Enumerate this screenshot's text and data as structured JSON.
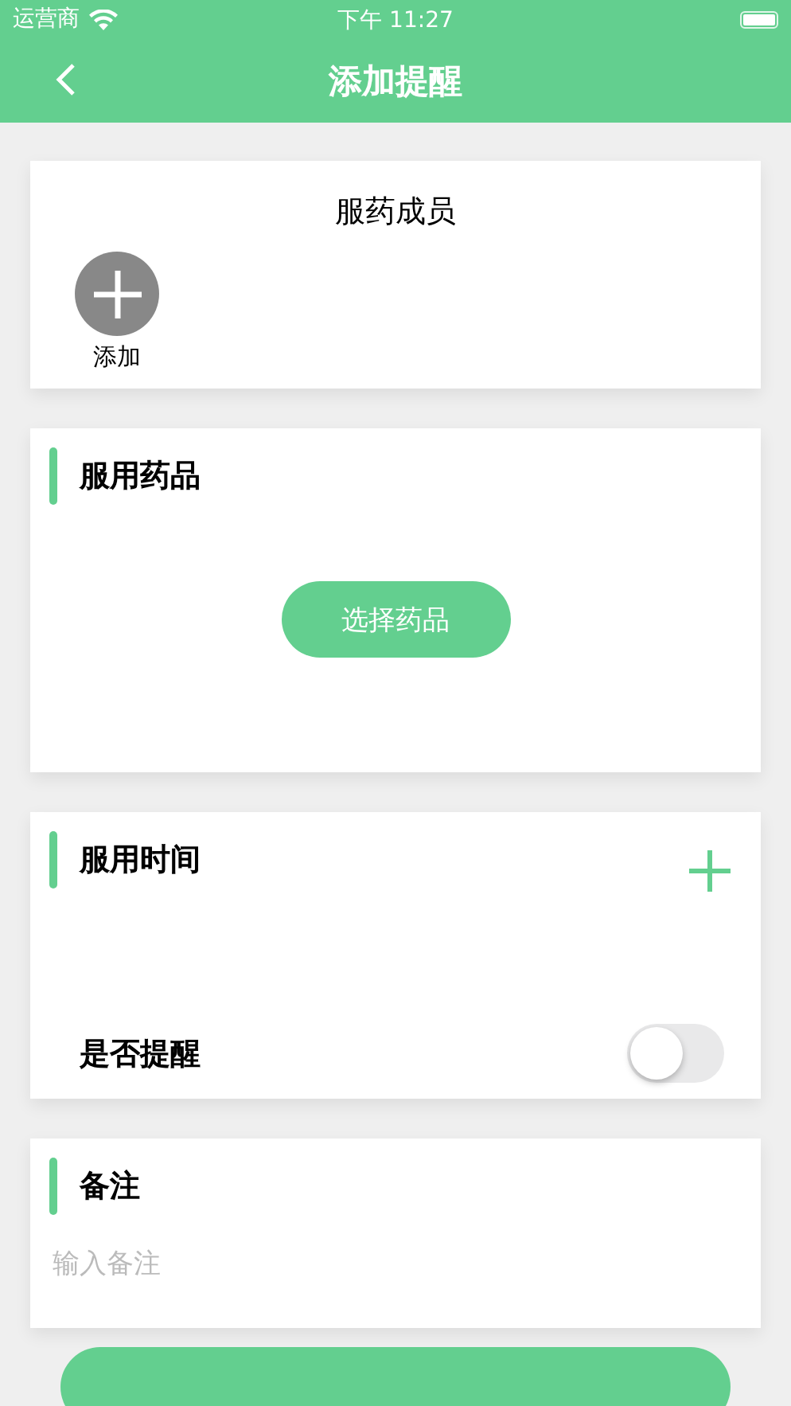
{
  "status_bar": {
    "carrier": "运营商",
    "time": "下午 11:27"
  },
  "nav": {
    "title": "添加提醒"
  },
  "members": {
    "title": "服药成员",
    "add_label": "添加"
  },
  "medicine": {
    "title": "服用药品",
    "button": "选择药品"
  },
  "dose_time": {
    "title": "服用时间",
    "remind_label": "是否提醒",
    "remind_on": false
  },
  "note": {
    "title": "备注",
    "placeholder": "输入备注"
  }
}
